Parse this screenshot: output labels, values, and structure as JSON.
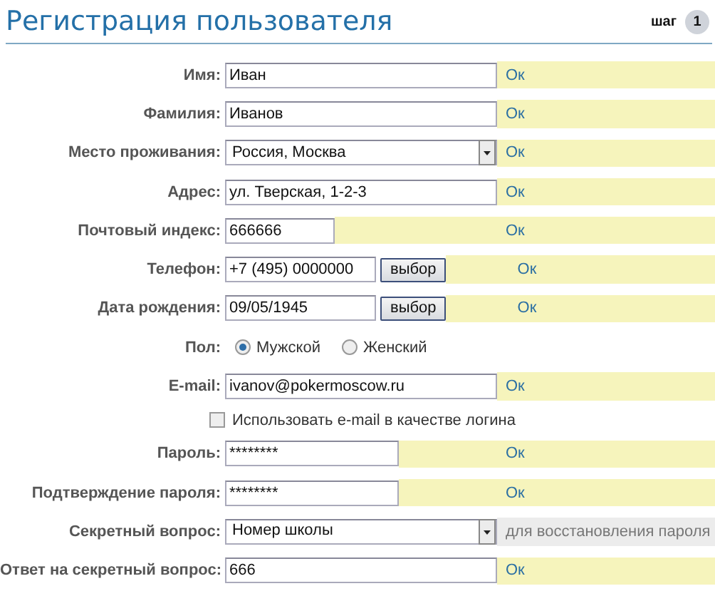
{
  "header": {
    "title": "Регистрация пользователя",
    "step_label": "шаг",
    "step_number": "1"
  },
  "rows": [
    {
      "label": "Имя:",
      "kind": "text",
      "value": "Иван",
      "status": {
        "kind": "ok",
        "text": "Ок"
      }
    },
    {
      "label": "Фамилия:",
      "kind": "text",
      "value": "Иванов",
      "status": {
        "kind": "ok",
        "text": "Ок"
      }
    },
    {
      "label": "Место проживания:",
      "kind": "select",
      "value": "Россия, Москва",
      "status": {
        "kind": "ok",
        "text": "Ок"
      }
    },
    {
      "label": "Адрес:",
      "kind": "text",
      "value": "ул. Тверская, 1-2-3",
      "status": {
        "kind": "ok",
        "text": "Ок"
      }
    },
    {
      "label": "Почтовый индекс:",
      "kind": "short",
      "value": "666666",
      "status": {
        "kind": "ok",
        "text": "Ок"
      }
    },
    {
      "label": "Телефон:",
      "kind": "picker",
      "value": "+7 (495) 0000000",
      "button": "выбор",
      "status": {
        "kind": "ok",
        "text": "Ок"
      }
    },
    {
      "label": "Дата рождения:",
      "kind": "picker",
      "value": "09/05/1945",
      "button": "выбор",
      "status": {
        "kind": "ok",
        "text": "Ок"
      }
    },
    {
      "label": "Пол:",
      "kind": "radio",
      "options": [
        {
          "label": "Мужской",
          "selected": true
        },
        {
          "label": "Женский",
          "selected": false
        }
      ]
    },
    {
      "label": "E-mail:",
      "kind": "text",
      "value": "ivanov@pokermoscow.ru",
      "status": {
        "kind": "ok",
        "text": "Ок"
      }
    },
    {
      "kind": "checkbox",
      "text": "Использовать e-mail в качестве логина",
      "checked": false
    },
    {
      "label": "Пароль:",
      "kind": "password",
      "value": "********",
      "status": {
        "kind": "ok",
        "text": "Ок"
      }
    },
    {
      "label": "Подтверждение пароля:",
      "kind": "password",
      "value": "********",
      "status": {
        "kind": "ok",
        "text": "Ок"
      }
    },
    {
      "label": "Секретный вопрос:",
      "kind": "select",
      "value": "Номер школы",
      "status": {
        "kind": "hint",
        "text": "для восстановления пароля"
      }
    },
    {
      "label": "Ответ на секретный вопрос:",
      "kind": "text",
      "value": "666",
      "status": {
        "kind": "ok",
        "text": "Ок"
      }
    }
  ]
}
